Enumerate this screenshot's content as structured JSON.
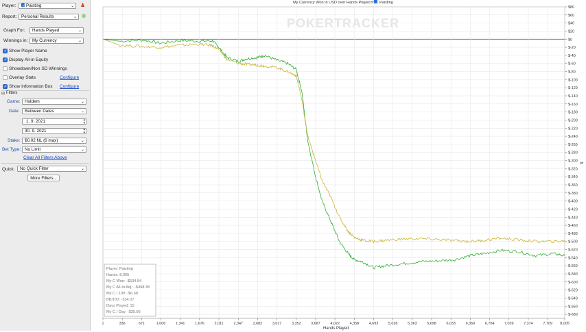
{
  "sidebar": {
    "player": {
      "label": "Player:",
      "value": "Paisting"
    },
    "report": {
      "label": "Report:",
      "value": "Personal Results"
    },
    "graph_for": {
      "label": "Graph For:",
      "value": "Hands Played"
    },
    "winnings_in": {
      "label": "Winnings in:",
      "value": "My Currency"
    },
    "checkboxes": [
      {
        "label": "Show Player Name",
        "checked": true
      },
      {
        "label": "Display All-in Equity",
        "checked": true
      },
      {
        "label": "Showdown/Non SD Winnings",
        "checked": false
      },
      {
        "label": "Overlay Stats",
        "checked": false,
        "link": "Configure"
      },
      {
        "label": "Show Information Box",
        "checked": true,
        "link": "Configure"
      }
    ],
    "filters": {
      "header": "Filters",
      "game": {
        "label": "Game:",
        "value": "Holdem"
      },
      "date": {
        "label": "Date:",
        "value": "Between Dates"
      },
      "date_from": "1. 9. 2021",
      "date_to": "30. 9. 2021",
      "stake": {
        "label": "Stake:",
        "value": "$0.02 NL (6 max)"
      },
      "bet_type": {
        "label": "Bet Type:",
        "value": "No Limit"
      },
      "clear_link": "Clear All Filters Above"
    },
    "quick": {
      "label": "Quick:",
      "value": "No Quick Filter"
    },
    "more_filters": "More Filters..."
  },
  "colors": {
    "won": "#33aa33",
    "allin": "#c8b43c",
    "link": "#1a48c4"
  },
  "chart_data": {
    "type": "line",
    "title": "My Currency Won in USD over Hands Played for",
    "title_player": "Paisting",
    "watermark": "POKERTRACKER",
    "xlabel": "Hands Played",
    "ylabel": "",
    "xlim": [
      1,
      8005
    ],
    "ylim": [
      -690,
      80
    ],
    "x_ticks": [
      1,
      336,
      671,
      1006,
      1341,
      1676,
      2011,
      2347,
      2682,
      3017,
      3352,
      3687,
      4022,
      4358,
      4693,
      5028,
      5363,
      5698,
      6033,
      6369,
      6704,
      7039,
      7374,
      7709,
      8005
    ],
    "y_ticks": [
      80,
      60,
      40,
      20,
      0,
      -20,
      -40,
      -60,
      -80,
      -100,
      -120,
      -140,
      -160,
      -180,
      -200,
      -220,
      -240,
      -260,
      -280,
      -300,
      -320,
      -340,
      -360,
      -380,
      -400,
      -420,
      -440,
      -460,
      -480,
      -500,
      -520,
      -540,
      -560,
      -580,
      -600,
      -620,
      -640,
      -660,
      -680
    ],
    "grid": true,
    "series": [
      {
        "name": "My C Won",
        "x": [
          1,
          300,
          700,
          1000,
          1341,
          1676,
          1900,
          2011,
          2150,
          2347,
          2500,
          2682,
          2800,
          3017,
          3200,
          3352,
          3450,
          3550,
          3687,
          3800,
          3950,
          4100,
          4250,
          4358,
          4500,
          4693,
          4900,
          5200,
          5500,
          5800,
          6100,
          6369,
          6600,
          6900,
          7200,
          7500,
          7800,
          8005
        ],
        "y": [
          0,
          -5,
          -2,
          -10,
          -3,
          -5,
          -4,
          -20,
          -45,
          -55,
          -48,
          -45,
          -40,
          -52,
          -60,
          -75,
          -130,
          -250,
          -340,
          -400,
          -450,
          -500,
          -530,
          -545,
          -550,
          -565,
          -560,
          -555,
          -550,
          -548,
          -545,
          -535,
          -530,
          -522,
          -525,
          -535,
          -530,
          -535
        ]
      },
      {
        "name": "My C All-In Adj.",
        "x": [
          1,
          300,
          700,
          1000,
          1341,
          1676,
          1900,
          2011,
          2150,
          2347,
          2500,
          2682,
          2800,
          3017,
          3200,
          3352,
          3450,
          3550,
          3687,
          3800,
          3950,
          4100,
          4250,
          4358,
          4500,
          4693,
          4900,
          5200,
          5500,
          5800,
          6100,
          6369,
          6600,
          6900,
          7200,
          7500,
          7800,
          8005
        ],
        "y": [
          0,
          -15,
          -18,
          -20,
          -15,
          -12,
          -16,
          -25,
          -50,
          -60,
          -62,
          -64,
          -66,
          -70,
          -80,
          -90,
          -150,
          -240,
          -300,
          -350,
          -390,
          -440,
          -475,
          -490,
          -497,
          -500,
          -497,
          -494,
          -493,
          -495,
          -498,
          -500,
          -497,
          -492,
          -496,
          -500,
          -500,
          -499
        ]
      }
    ],
    "info_box": {
      "lines": [
        "Player: Paisting",
        "Hands: 8,005",
        "My C Won: -$534.84",
        "My C All-In Adj.: -$498.38",
        "My C / 100: -$6.68",
        "BB/100: -334.07",
        "Days Played: 15",
        "My C / Day: -$35.66"
      ]
    }
  }
}
